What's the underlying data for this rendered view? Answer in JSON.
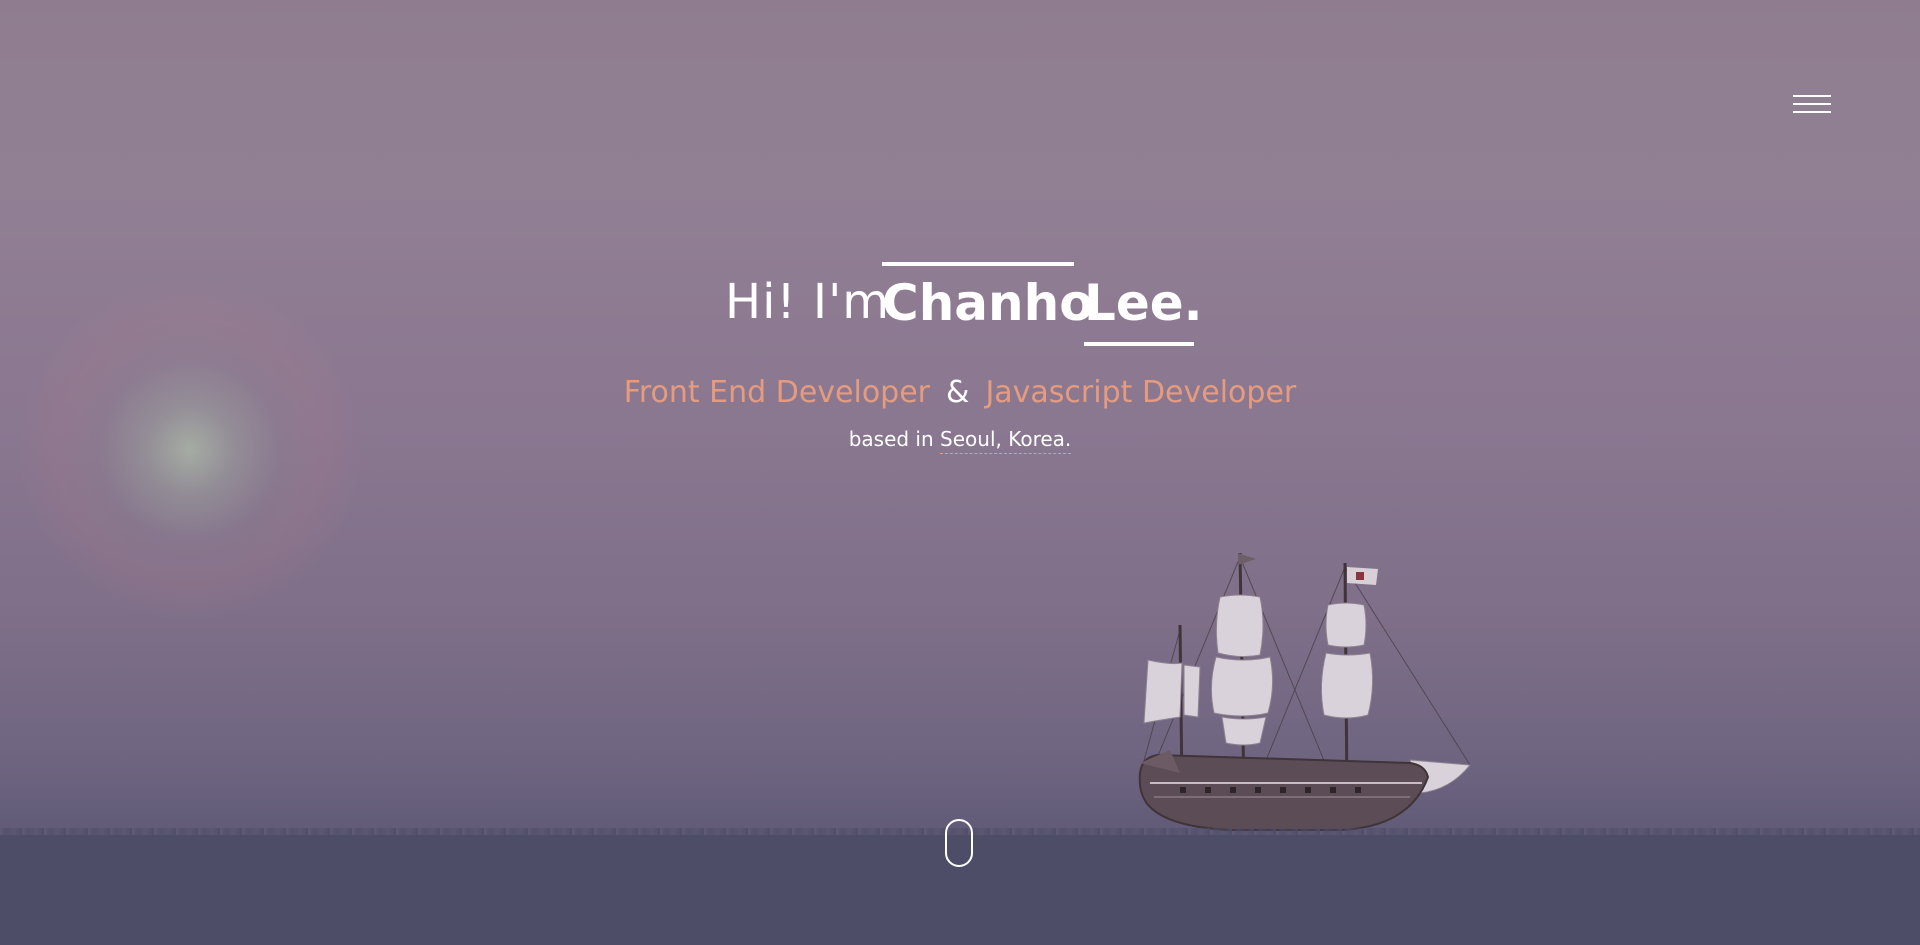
{
  "header": {
    "menu_icon": "hamburger-icon"
  },
  "hero": {
    "greeting": "Hi! I'm",
    "first_name": "Chanho",
    "last_name": "Lee.",
    "role_1": "Front End Developer",
    "ampersand": "&",
    "role_2": "Javascript Developer",
    "location_prefix": "based in",
    "location": "Seoul, Korea."
  },
  "scroll": {
    "icon": "mouse-scroll-icon"
  },
  "colors": {
    "accent": "#e59b7e",
    "sky": "#8f7d8f",
    "sea": "#4d4d68",
    "text": "#ffffff"
  }
}
